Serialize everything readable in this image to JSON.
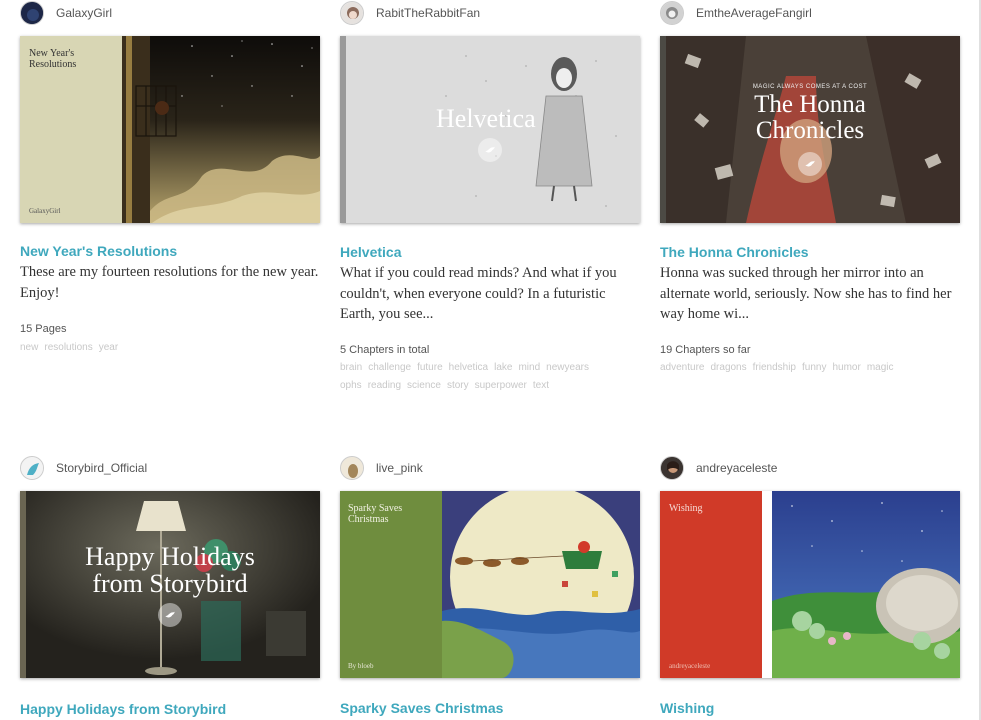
{
  "cards": [
    {
      "author": "GalaxyGirl",
      "title": "New Year's Resolutions",
      "description": "These are my fourteen resolutions for the new year. Enjoy!",
      "meta": "15 Pages",
      "tags": [
        "new",
        "resolutions",
        "year"
      ],
      "cover_title": "New Year's Resolutions",
      "cover_author": "GalaxyGirl",
      "colors": {
        "accent": "#d8d6b4",
        "sky": "#1a1612"
      }
    },
    {
      "author": "RabitTheRabbitFan",
      "title": "Helvetica",
      "description": "What if you could read minds? And what if you couldn't, when everyone could? In a futuristic Earth, you see...",
      "meta": "5 Chapters in total",
      "tags": [
        "brain",
        "challenge",
        "future",
        "helvetica",
        "lake",
        "mind",
        "newyears",
        "ophs",
        "reading",
        "science",
        "story",
        "superpower",
        "text"
      ],
      "cover_title": "Helvetica",
      "colors": {
        "accent": "#d6d6d6"
      }
    },
    {
      "author": "EmtheAverageFangirl",
      "title": "The Honna Chronicles",
      "description": "Honna was sucked through her mirror into an alternate world, seriously. Now she has to find her way home wi...",
      "meta": "19 Chapters so far",
      "tags": [
        "adventure",
        "dragons",
        "friendship",
        "funny",
        "humor",
        "magic"
      ],
      "cover_title": "The Honna Chronicles",
      "cover_subtitle": "MAGIC ALWAYS COMES AT A COST",
      "colors": {
        "accent": "#4a4038"
      }
    },
    {
      "author": "Storybird_Official",
      "title": "Happy Holidays from Storybird",
      "cover_title": "Happy Holidays from Storybird",
      "colors": {
        "accent": "#2e2b24"
      }
    },
    {
      "author": "live_pink",
      "title": "Sparky Saves Christmas",
      "cover_title": "Sparky Saves Christmas",
      "cover_author": "By bloeb",
      "colors": {
        "accent": "#6f8d3e",
        "sky": "#3a3f7c"
      }
    },
    {
      "author": "andreyaceleste",
      "title": "Wishing",
      "cover_title": "Wishing",
      "cover_author": "andreyaceleste",
      "colors": {
        "accent": "#d03a28",
        "sky": "#2b3f8e"
      }
    }
  ]
}
